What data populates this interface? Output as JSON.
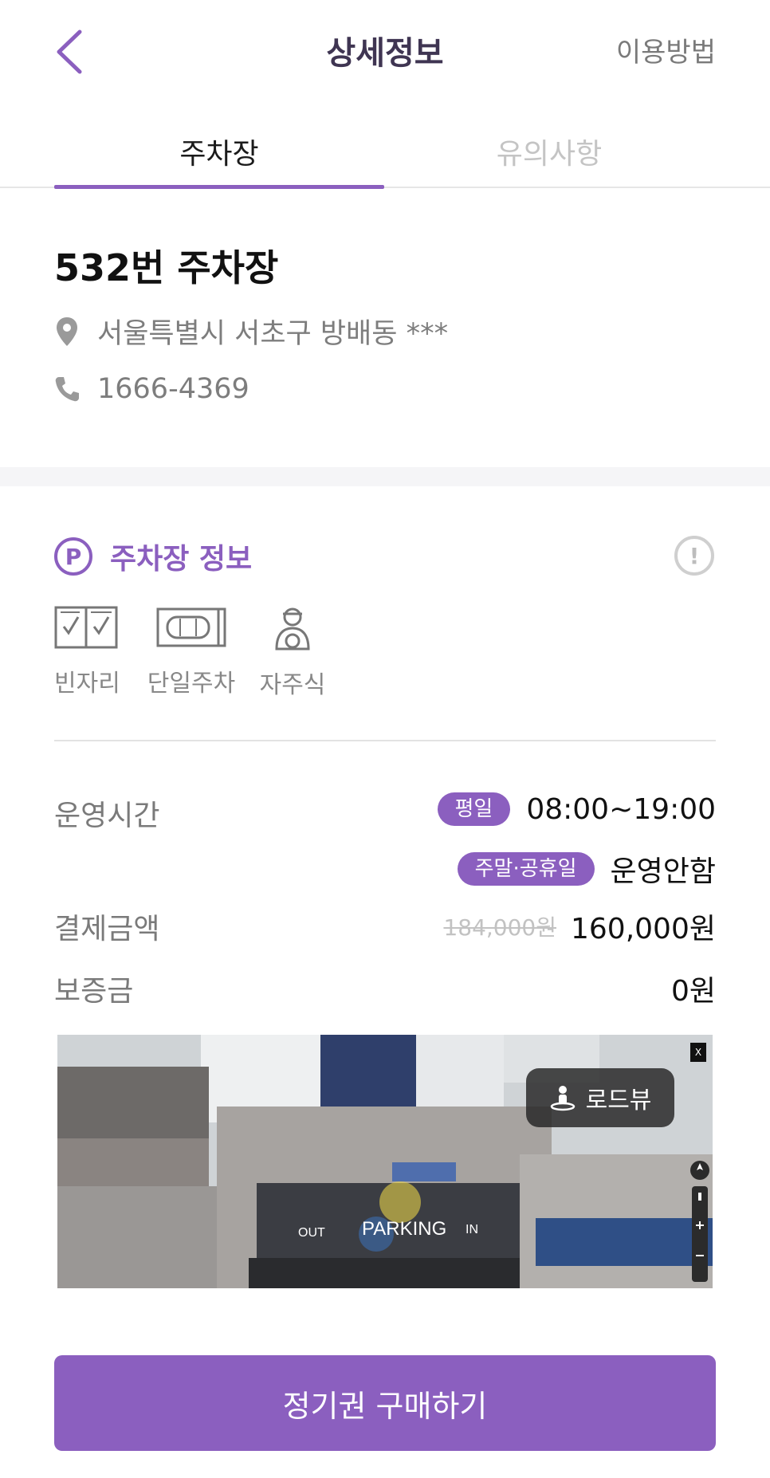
{
  "header": {
    "title": "상세정보",
    "howto_label": "이용방법"
  },
  "tabs": [
    {
      "label": "주차장",
      "active": true
    },
    {
      "label": "유의사항",
      "active": false
    }
  ],
  "lot": {
    "name": "532번 주차장",
    "address": "서울특별시 서초구 방배동 ***",
    "phone": "1666-4369"
  },
  "section": {
    "icon_letter": "P",
    "title": "주차장 정보",
    "info_icon": "!"
  },
  "features": [
    {
      "label": "빈자리",
      "icon": "checkbox-icon"
    },
    {
      "label": "단일주차",
      "icon": "single-car-icon"
    },
    {
      "label": "자주식",
      "icon": "driver-icon"
    }
  ],
  "hours": {
    "label": "운영시간",
    "weekday_badge": "평일",
    "weekday_value": "08:00~19:00",
    "weekend_badge": "주말·공휴일",
    "weekend_value": "운영안함"
  },
  "payment": {
    "label": "결제금액",
    "original_price": "184,000원",
    "price": "160,000원"
  },
  "deposit": {
    "label": "보증금",
    "value": "0원"
  },
  "streetview": {
    "button_label": "로드뷰",
    "close_label": "X",
    "sign_text": "PARKING",
    "out_text": "OUT",
    "in_text": "IN"
  },
  "cta": {
    "label": "정기권 구매하기"
  },
  "colors": {
    "accent": "#8b5fbf",
    "title": "#3f3552",
    "muted": "#7a7a7a"
  }
}
